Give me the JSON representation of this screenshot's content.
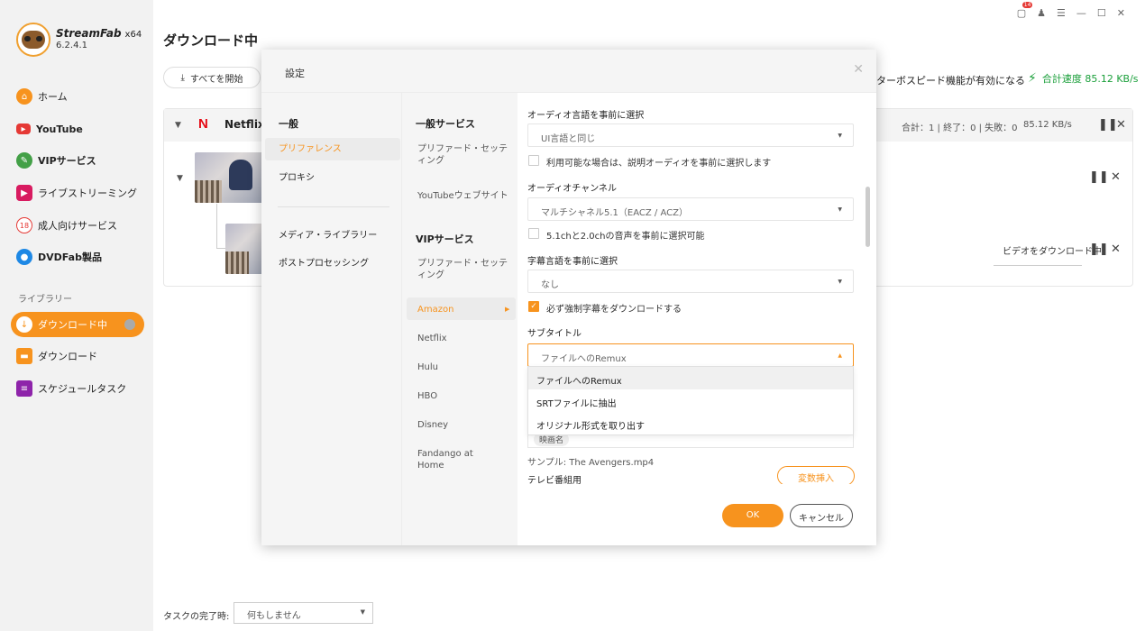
{
  "app": {
    "brand": "StreamFab",
    "arch": "x64",
    "version": "6.2.4.1"
  },
  "sidebar": {
    "items": [
      {
        "label": "ホーム",
        "icon": "home-icon",
        "color": "#f7931e"
      },
      {
        "label": "YouTube",
        "icon": "youtube-icon",
        "color": "#e53935"
      },
      {
        "label": "VIPサービス",
        "icon": "key-icon",
        "color": "#43a047"
      },
      {
        "label": "ライブストリーミング",
        "icon": "live-icon",
        "color": "#d81b60"
      },
      {
        "label": "成人向けサービス",
        "icon": "adult-icon",
        "color": "#e53935"
      },
      {
        "label": "DVDFab製品",
        "icon": "dvdfab-icon",
        "color": "#1e88e5"
      }
    ],
    "library_label": "ライブラリー",
    "library_items": [
      {
        "label": "ダウンロード中",
        "icon": "download-icon",
        "active": true
      },
      {
        "label": "ダウンロード",
        "icon": "folder-icon",
        "color": "#f7931e"
      },
      {
        "label": "スケジュールタスク",
        "icon": "schedule-icon",
        "color": "#8e24aa"
      }
    ]
  },
  "topbar": {
    "notification_count": "14"
  },
  "main": {
    "title": "ダウンロード中",
    "start_all": "すべてを開始",
    "turbo": "ターボスピード機能が有効になる",
    "total_speed": "合計速度 85.12 KB/s",
    "task": {
      "name": "Netflix",
      "logo": "N",
      "stats": "合計：1 | 終了：0 | 失敗：0",
      "speed": "85.12 KB/s",
      "sub_status": "ビデオをダウンロード中"
    },
    "footer_label": "タスクの完了時:",
    "footer_value": "何もしません"
  },
  "dialog": {
    "title": "設定",
    "col1": {
      "general": "一般",
      "preferences": "プリファレンス",
      "proxy": "プロキシ",
      "media_library": "メディア・ライブラリー",
      "post_processing": "ポストプロセッシング"
    },
    "col2": {
      "general_services": "一般サービス",
      "preferred_settings_1": "プリファード・セッティング",
      "youtube_site": "YouTubeウェブサイト",
      "vip_services": "VIPサービス",
      "preferred_settings_2": "プリファード・セッティング",
      "services": [
        "Amazon",
        "Netflix",
        "Hulu",
        "HBO",
        "Disney",
        "Fandango at Home"
      ]
    },
    "settings": {
      "audio_lang_label": "オーディオ言語を事前に選択",
      "audio_lang_value": "UI言語と同じ",
      "audio_desc_cb": "利用可能な場合は、説明オーディオを事前に選択します",
      "audio_channel_label": "オーディオチャンネル",
      "audio_channel_value": "マルチシャネル5.1（EACZ / ACZ）",
      "channel_cb": "5.1chと2.0chの音声を事前に選択可能",
      "subtitle_lang_label": "字幕言語を事前に選択",
      "subtitle_lang_value": "なし",
      "forced_sub_cb": "必ず強制字幕をダウンロードする",
      "subtitle_label": "サブタイトル",
      "subtitle_value": "ファイルへのRemux",
      "subtitle_options": [
        "ファイルへのRemux",
        "SRTファイルに抽出",
        "オリジナル形式を取り出す"
      ],
      "chip": "映画名",
      "sample": "サンプル: The Avengers.mp4",
      "tv_label": "テレビ番組用",
      "insert_var": "変数挿入"
    },
    "ok": "OK",
    "cancel": "キャンセル"
  }
}
